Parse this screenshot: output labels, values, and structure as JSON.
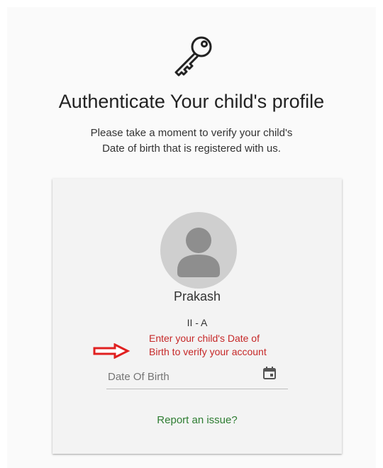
{
  "header": {
    "icon": "key-icon",
    "title": "Authenticate Your child's profile",
    "subtitle_line1": "Please take a moment to verify your child's",
    "subtitle_line2": "Date of birth that is registered with us."
  },
  "card": {
    "avatar_icon": "user-avatar-icon",
    "student_name": "Prakash",
    "student_class": "II - A",
    "annotation_line1": "Enter your child's Date of",
    "annotation_line2": "Birth to verify your account",
    "arrow_icon": "right-arrow-icon",
    "dob_placeholder": "Date Of Birth",
    "calendar_icon": "calendar-icon",
    "report_link": "Report an issue?"
  },
  "colors": {
    "annotation": "#c62828",
    "link": "#2e7d32",
    "card_bg": "#f3f3f3",
    "avatar_bg": "#cfcfcf"
  }
}
